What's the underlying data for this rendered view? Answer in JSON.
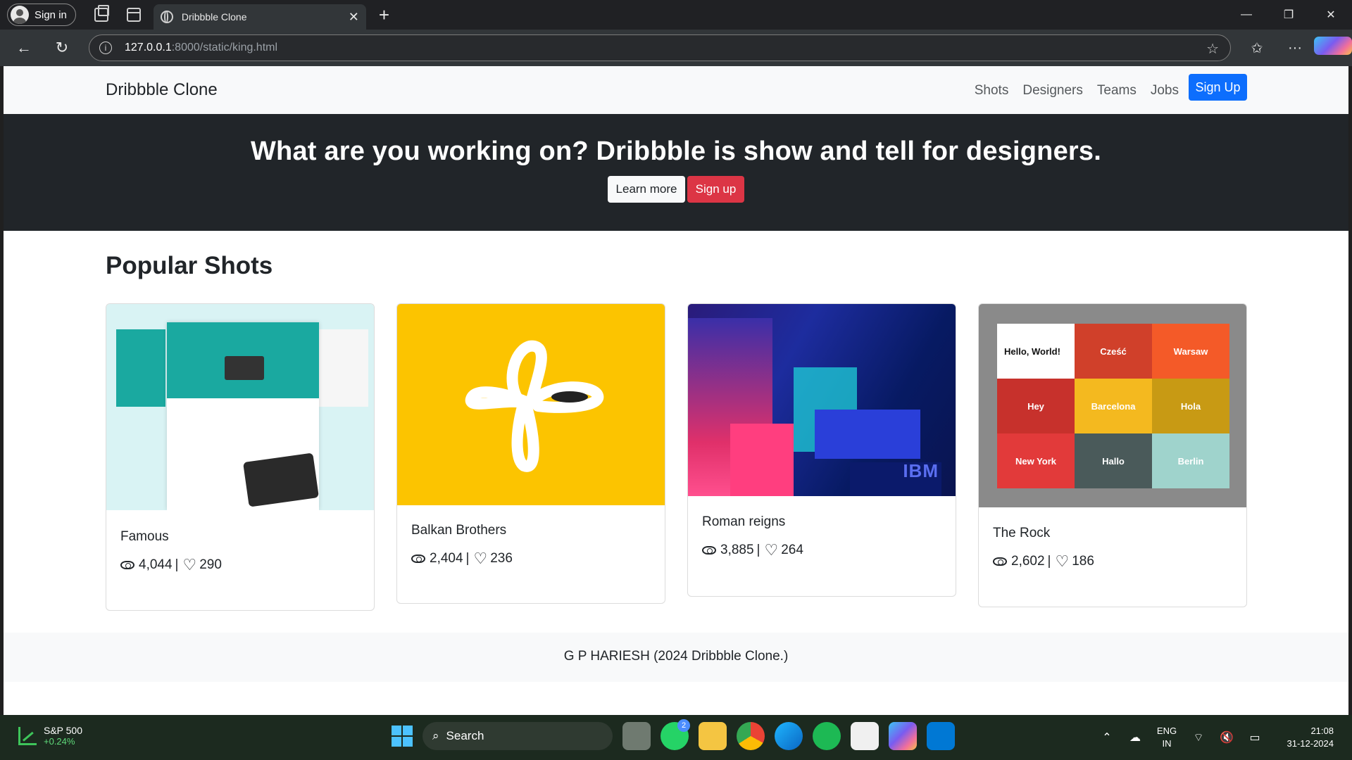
{
  "browser": {
    "profile_label": "Sign in",
    "tab_title": "Dribbble Clone",
    "tab_close": "✕",
    "new_tab": "+",
    "url_host": "127.0.0.1",
    "url_path": ":8000/static/king.html",
    "window_controls": [
      "—",
      "❐",
      "✕"
    ]
  },
  "site": {
    "brand": "Dribbble Clone",
    "nav": [
      "Shots",
      "Designers",
      "Teams",
      "Jobs"
    ],
    "signup_button": "Sign Up",
    "hero_title": "What are you working on? Dribbble is show and tell for designers.",
    "learn_more": "Learn more",
    "sign_up": "Sign up",
    "section_title": "Popular Shots",
    "shots": [
      {
        "title": "Famous",
        "views": "4,044",
        "likes": "290"
      },
      {
        "title": "Balkan Brothers",
        "views": "2,404",
        "likes": "236"
      },
      {
        "title": "Roman reigns",
        "views": "3,885",
        "likes": "264"
      },
      {
        "title": "The Rock",
        "views": "2,602",
        "likes": "186"
      }
    ],
    "stat_separator": "|",
    "footer": "G P HARIESH (2024 Dribbble Clone.)",
    "thumb_texts": {
      "ibm": "IBM",
      "cities": [
        "Hello, World!",
        "Cześć",
        "Warsaw",
        "Hey",
        "Barcelona",
        "Hola",
        "New York",
        "Hallo",
        "Berlin"
      ]
    }
  },
  "taskbar": {
    "stock_name": "S&P 500",
    "stock_change": "+0.24%",
    "search_label": "Search",
    "whatsapp_badge": "2",
    "lang_1": "ENG",
    "lang_2": "IN",
    "time": "21:08",
    "date": "31-12-2024"
  },
  "colors": {
    "primary": "#0d6efd",
    "danger": "#dc3545",
    "hero_bg": "#212529",
    "navbar_bg": "#f8f9fa"
  }
}
